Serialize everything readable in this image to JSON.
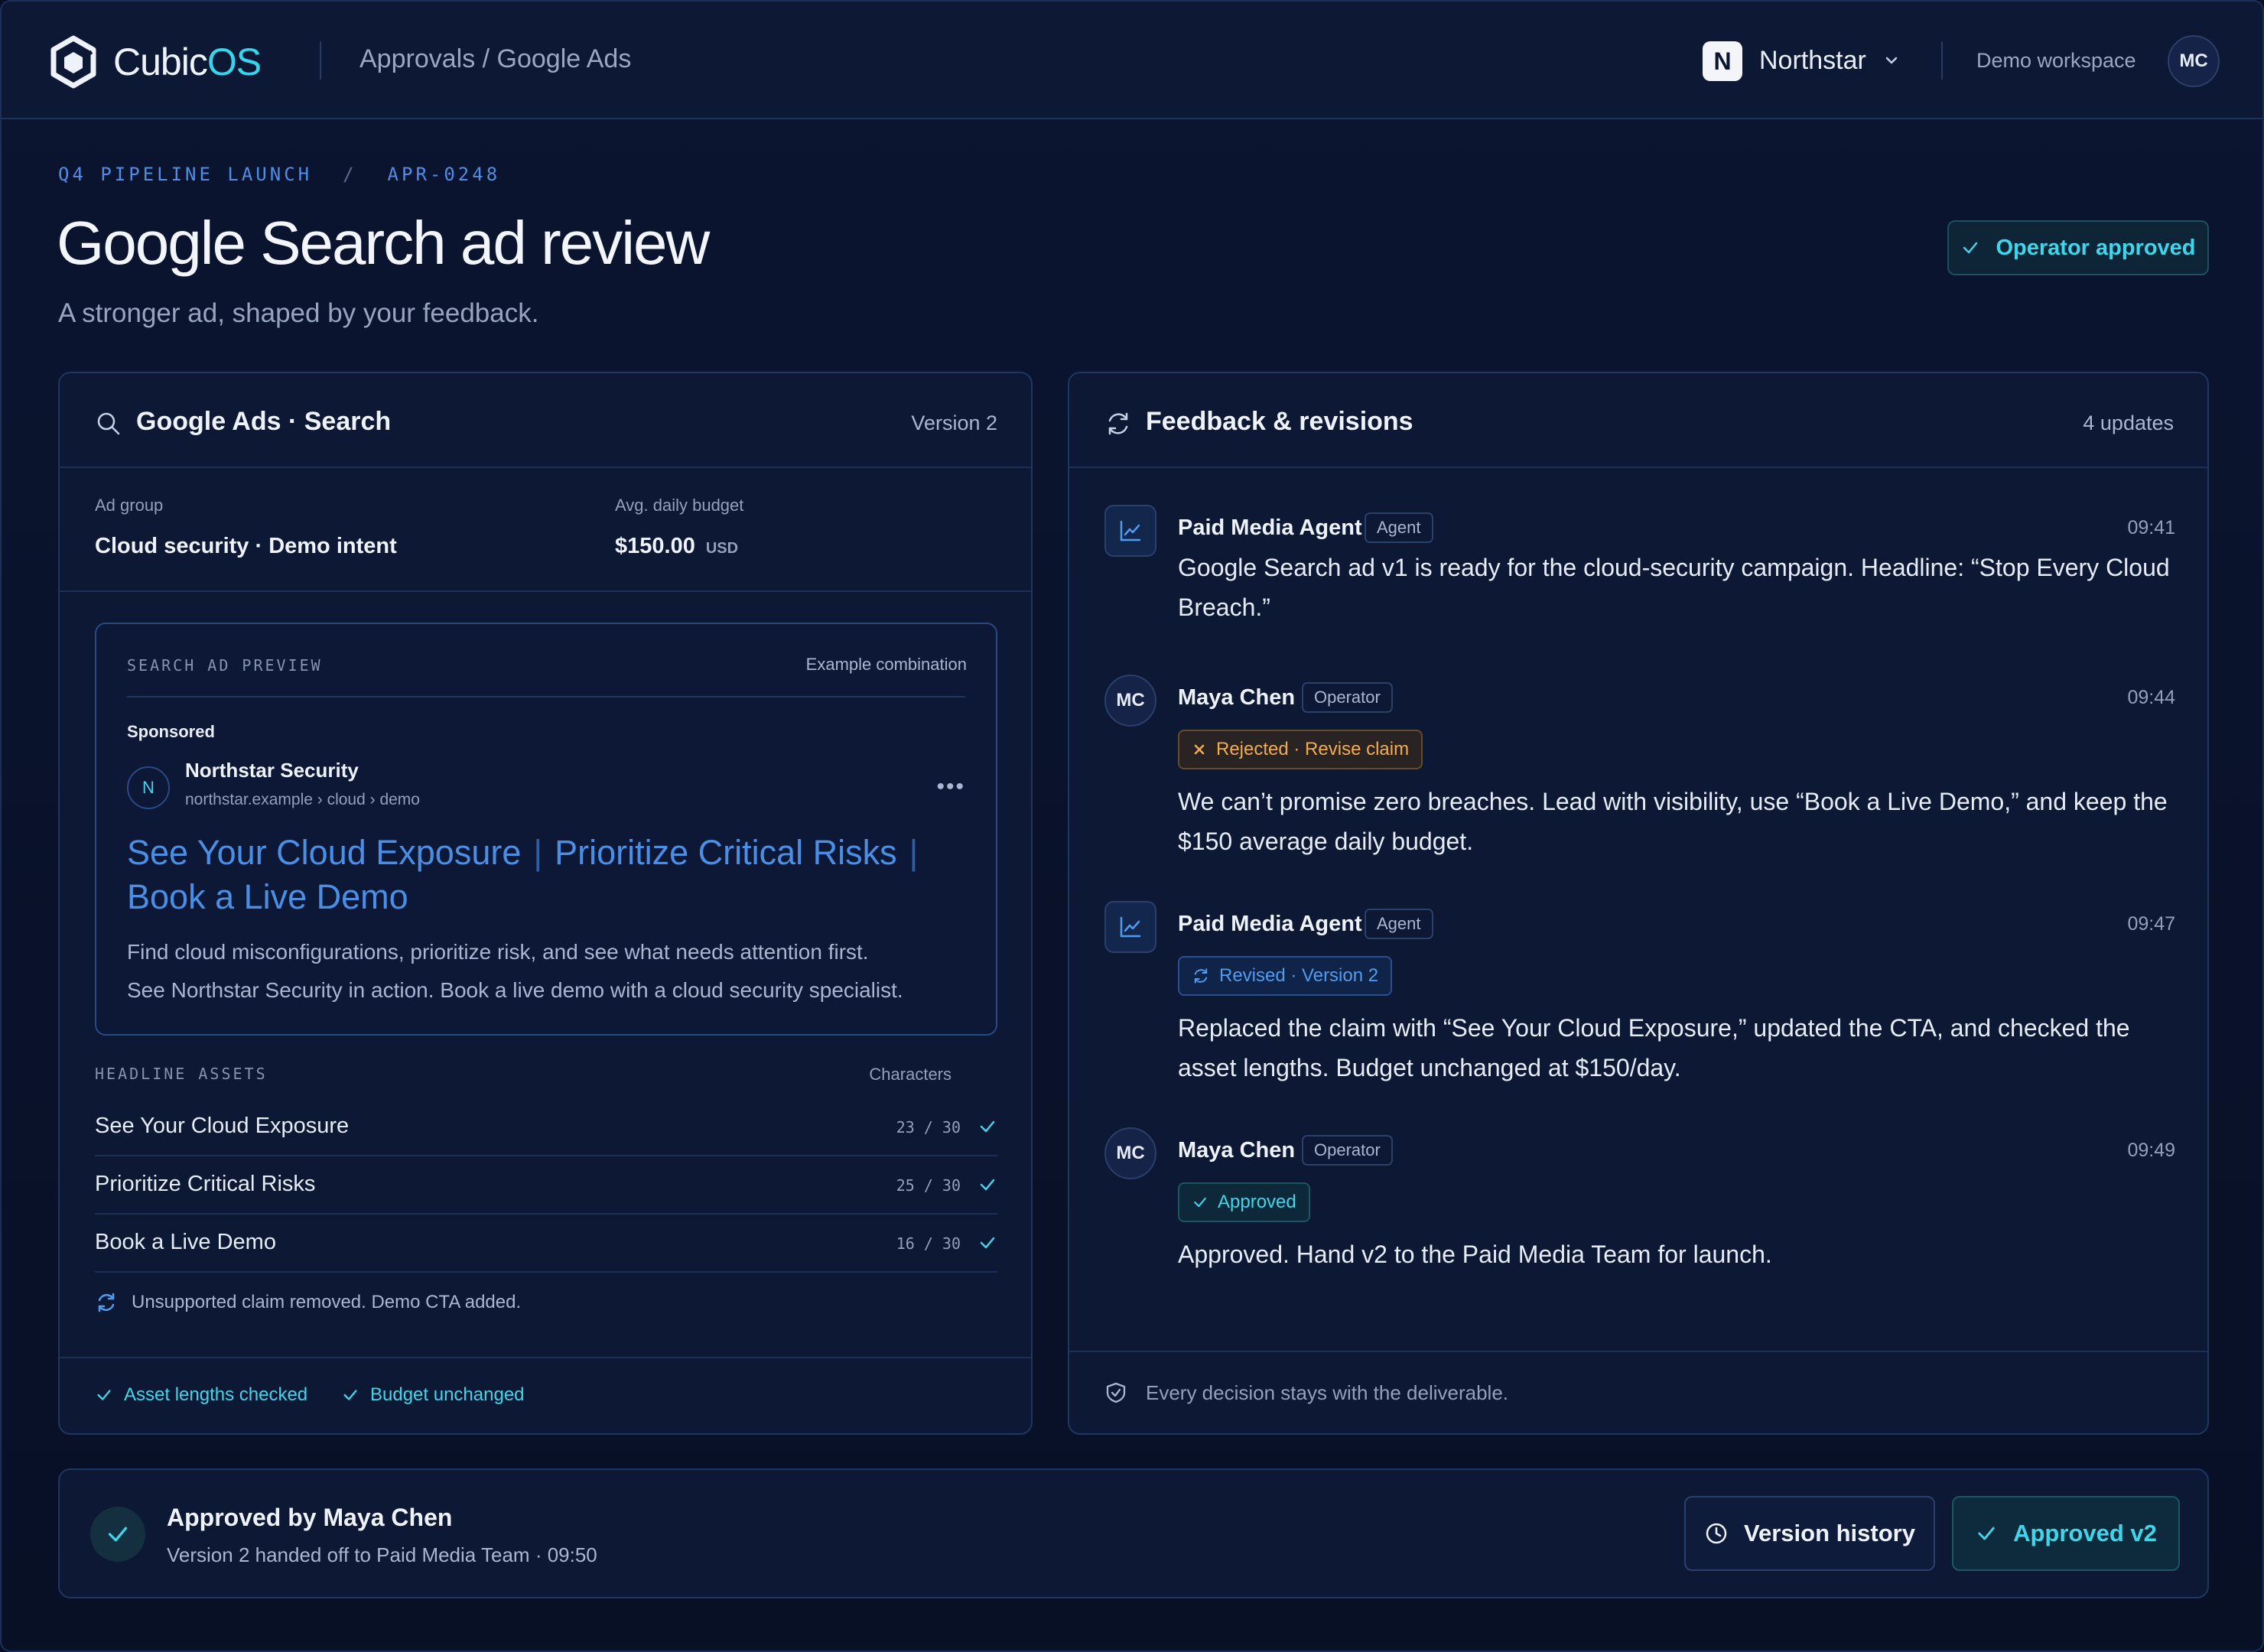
{
  "app": {
    "logo_text_a": "Cubic",
    "logo_text_b": "OS",
    "breadcrumb": "Approvals / Google Ads",
    "workspace_initial": "N",
    "workspace_name": "Northstar",
    "workspace_label": "Demo workspace",
    "user_initials": "MC"
  },
  "page": {
    "crumb_project": "Q4 PIPELINE LAUNCH",
    "crumb_sep": "/",
    "crumb_id": "APR-0248",
    "title": "Google Search ad review",
    "subtitle": "A stronger ad, shaped by your feedback.",
    "status": "Operator approved"
  },
  "ad_card": {
    "title": "Google Ads · Search",
    "version": "Version 2",
    "ad_group_label": "Ad group",
    "ad_group_value": "Cloud security · Demo intent",
    "budget_label": "Avg. daily budget",
    "budget_value": "$150.00",
    "budget_currency": "USD",
    "preview": {
      "label": "SEARCH AD PREVIEW",
      "example": "Example combination",
      "sponsored": "Sponsored",
      "advertiser_initial": "N",
      "advertiser": "Northstar Security",
      "url": "northstar.example › cloud › demo",
      "headline_1": "See Your Cloud Exposure",
      "headline_2": "Prioritize Critical Risks",
      "headline_3": "Book a Live Demo",
      "pipe": "|",
      "description_1": "Find cloud misconfigurations, prioritize risk, and see what needs attention first.",
      "description_2": "See Northstar Security in action. Book a live demo with a cloud security specialist."
    },
    "assets_label": "HEADLINE ASSETS",
    "characters_label": "Characters",
    "assets": [
      {
        "text": "See Your Cloud Exposure",
        "count": "23 / 30"
      },
      {
        "text": "Prioritize Critical Risks",
        "count": "25 / 30"
      },
      {
        "text": "Book a Live Demo",
        "count": "16 / 30"
      }
    ],
    "note": "Unsupported claim removed. Demo CTA added.",
    "footer_1": "Asset lengths checked",
    "footer_2": "Budget unchanged"
  },
  "feedback_card": {
    "title": "Feedback & revisions",
    "count": "4 updates",
    "items": [
      {
        "initials": "",
        "name": "Paid Media Agent",
        "role": "Agent",
        "time": "09:41",
        "status": "",
        "text": "Google Search ad v1 is ready for the cloud-security campaign. Headline: “Stop Every Cloud Breach.”"
      },
      {
        "initials": "MC",
        "name": "Maya Chen",
        "role": "Operator",
        "time": "09:44",
        "status": "Rejected · Revise claim",
        "text": "We can’t promise zero breaches. Lead with visibility, use “Book a Live Demo,” and keep the $150 average daily budget."
      },
      {
        "initials": "",
        "name": "Paid Media Agent",
        "role": "Agent",
        "time": "09:47",
        "status": "Revised · Version 2",
        "text": "Replaced the claim with “See Your Cloud Exposure,” updated the CTA, and checked the asset lengths. Budget unchanged at $150/day."
      },
      {
        "initials": "MC",
        "name": "Maya Chen",
        "role": "Operator",
        "time": "09:49",
        "status": "Approved",
        "text": "Approved. Hand v2 to the Paid Media Team for launch."
      }
    ],
    "footer": "Every decision stays with the deliverable."
  },
  "bottom": {
    "title": "Approved by Maya Chen",
    "subtitle": "Version 2 handed off to Paid Media Team · 09:50",
    "history_button": "Version history",
    "approved_button": "Approved v2"
  },
  "colors": {
    "accent_cyan": "#3fd5ea",
    "accent_blue": "#4a8fe6",
    "rejected": "#f2ad4a",
    "background": "#081027"
  }
}
